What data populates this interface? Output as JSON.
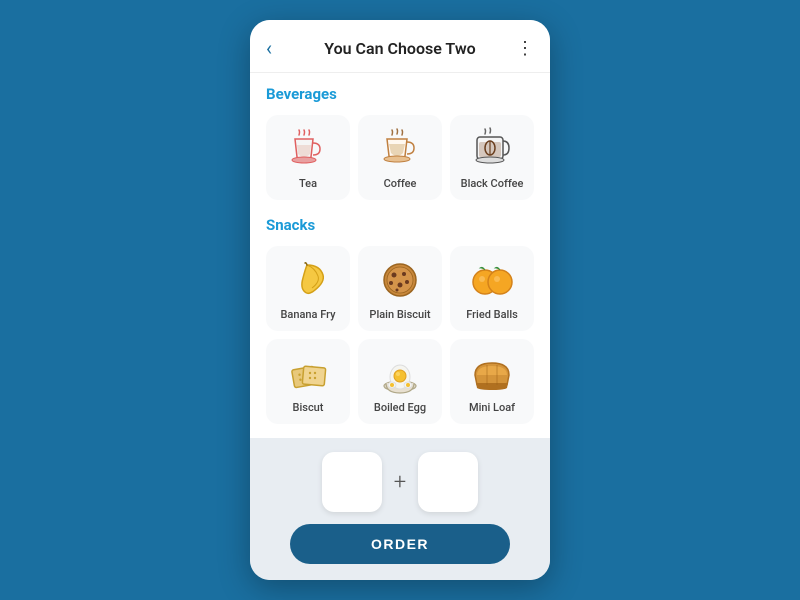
{
  "header": {
    "title": "You Can Choose Two",
    "back_icon": "‹",
    "more_icon": "⋮"
  },
  "sections": [
    {
      "label": "Beverages",
      "items": [
        {
          "name": "Tea",
          "icon": "tea"
        },
        {
          "name": "Coffee",
          "icon": "coffee"
        },
        {
          "name": "Black Coffee",
          "icon": "black-coffee"
        }
      ]
    },
    {
      "label": "Snacks",
      "items": [
        {
          "name": "Banana Fry",
          "icon": "banana"
        },
        {
          "name": "Plain Biscuit",
          "icon": "biscuit-round"
        },
        {
          "name": "Fried Balls",
          "icon": "fried-balls"
        },
        {
          "name": "Biscut",
          "icon": "biscuit-square"
        },
        {
          "name": "Boiled Egg",
          "icon": "boiled-egg"
        },
        {
          "name": "Mini Loaf",
          "icon": "mini-loaf"
        }
      ]
    }
  ],
  "bottom": {
    "plus_label": "+",
    "order_button": "ORDER"
  }
}
